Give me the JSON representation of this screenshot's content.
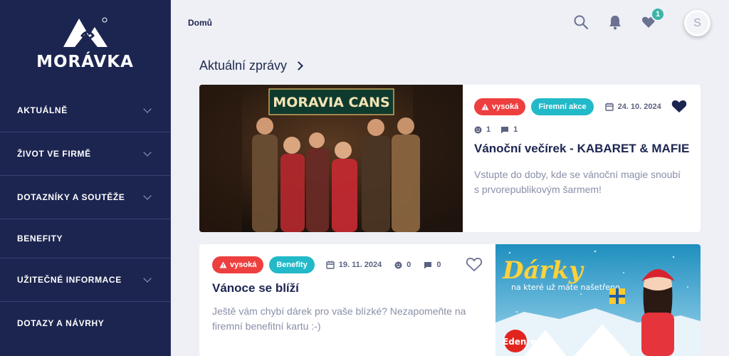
{
  "brand": {
    "name": "MORÁVKA"
  },
  "sidebar": {
    "items": [
      {
        "label": "AKTUÁLNĚ",
        "expandable": true
      },
      {
        "label": "ŽIVOT VE FIRMĚ",
        "expandable": true
      },
      {
        "label": "DOTAZNÍKY A SOUTĚŽE",
        "expandable": true
      },
      {
        "label": "BENEFITY",
        "expandable": false
      },
      {
        "label": "UŽITEČNÉ INFORMACE",
        "expandable": true
      },
      {
        "label": "DOTAZY A NÁVRHY",
        "expandable": false
      }
    ]
  },
  "header": {
    "breadcrumb": "Domů",
    "favorites_count": "1",
    "avatar_initial": "S",
    "icons": [
      "search-icon",
      "bell-icon",
      "heart-icon"
    ]
  },
  "main": {
    "section_title": "Aktuální zprávy",
    "posts": [
      {
        "image_sign_text": "MORAVIA CANS",
        "priority": "vysoká",
        "category": "Firemní akce",
        "date": "24. 10. 2024",
        "reactions": "1",
        "comments": "1",
        "favorited": true,
        "title": "Vánoční večírek - KABARET & MAFIE",
        "excerpt": "Vstupte do doby, kde se vánoční magie snoubí s prvorepublikovým šarmem!"
      },
      {
        "priority": "vysoká",
        "category": "Benefity",
        "date": "19. 11. 2024",
        "reactions": "0",
        "comments": "0",
        "favorited": false,
        "title": "Vánoce se blíží",
        "excerpt": "Ještě vám chybí dárek pro vaše blízké? Nezapomeňte na firemní benefitní kartu :-)",
        "image_heading": "Dárky",
        "image_subheading": "na které už máte našetřeno",
        "image_brand": "Edenred"
      }
    ]
  },
  "colors": {
    "sidebar_bg": "#1c2550",
    "priority_red": "#ee3f3f",
    "category_cyan": "#22b9c8",
    "badge_teal": "#3bb5a7"
  }
}
